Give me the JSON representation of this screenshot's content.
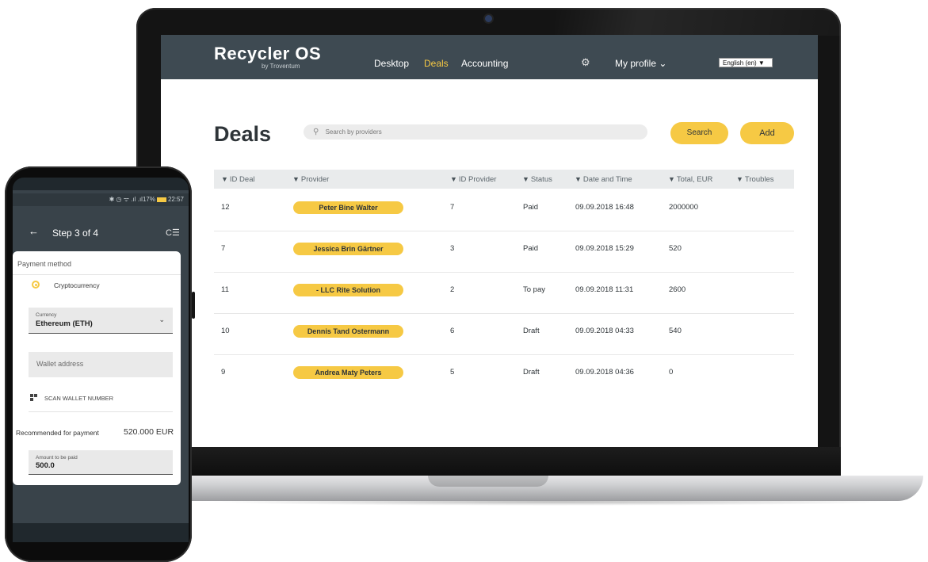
{
  "app": {
    "brand": "Recycler OS",
    "brand_sub": "by Troventum",
    "nav": [
      "Desktop",
      "Deals",
      "Accounting"
    ],
    "active_nav": "Deals",
    "profile": "My profile ⌄",
    "language": "English (en) ▼"
  },
  "deals": {
    "title": "Deals",
    "search_placeholder": "Search by providers",
    "search_button": "Search",
    "add_button": "Add",
    "columns": [
      "ID Deal",
      "Provider",
      "ID Provider",
      "Status",
      "Date and Time",
      "Total, EUR",
      "Troubles"
    ],
    "rows": [
      {
        "id": "12",
        "provider": "Peter Bine Walter",
        "provider_id": "7",
        "status": "Paid",
        "datetime": "09.09.2018 16:48",
        "total": "2000000",
        "troubles": ""
      },
      {
        "id": "7",
        "provider": "Jessica Brin Gärtner",
        "provider_id": "3",
        "status": "Paid",
        "datetime": "09.09.2018 15:29",
        "total": "520",
        "troubles": ""
      },
      {
        "id": "11",
        "provider": "- LLC Rite Solution",
        "provider_id": "2",
        "status": "To pay",
        "datetime": "09.09.2018 11:31",
        "total": "2600",
        "troubles": ""
      },
      {
        "id": "10",
        "provider": "Dennis Tand Ostermann",
        "provider_id": "6",
        "status": "Draft",
        "datetime": "09.09.2018 04:33",
        "total": "540",
        "troubles": ""
      },
      {
        "id": "9",
        "provider": "Andrea Maty Peters",
        "provider_id": "5",
        "status": "Draft",
        "datetime": "09.09.2018 04:36",
        "total": "0",
        "troubles": ""
      }
    ],
    "accent_color": "#f6c944",
    "header_color": "#3e4a52"
  },
  "phone": {
    "status_left": "✱ ◷ ᯤ .ıl .ıl17%",
    "status_time": "22:57",
    "step": "Step 3 of 4",
    "payment_method_label": "Payment method",
    "payment_option": "Cryptocurrency",
    "currency_label": "Currency",
    "currency_value": "Ethereum (ETH)",
    "wallet_placeholder": "Wallet address",
    "scan_label": "SCAN WALLET NUMBER",
    "recommended_label": "Recommended for payment",
    "recommended_value": "520.000 EUR",
    "amount_label": "Amount to be paid",
    "amount_value": "500.0"
  },
  "icons": {
    "search": "search-icon",
    "filter": "filter-icon",
    "settings": "gear-icon",
    "back": "arrow-back-icon",
    "menu": "menu-icon",
    "qr": "qr-code-icon",
    "chevron": "chevron-down-icon"
  }
}
